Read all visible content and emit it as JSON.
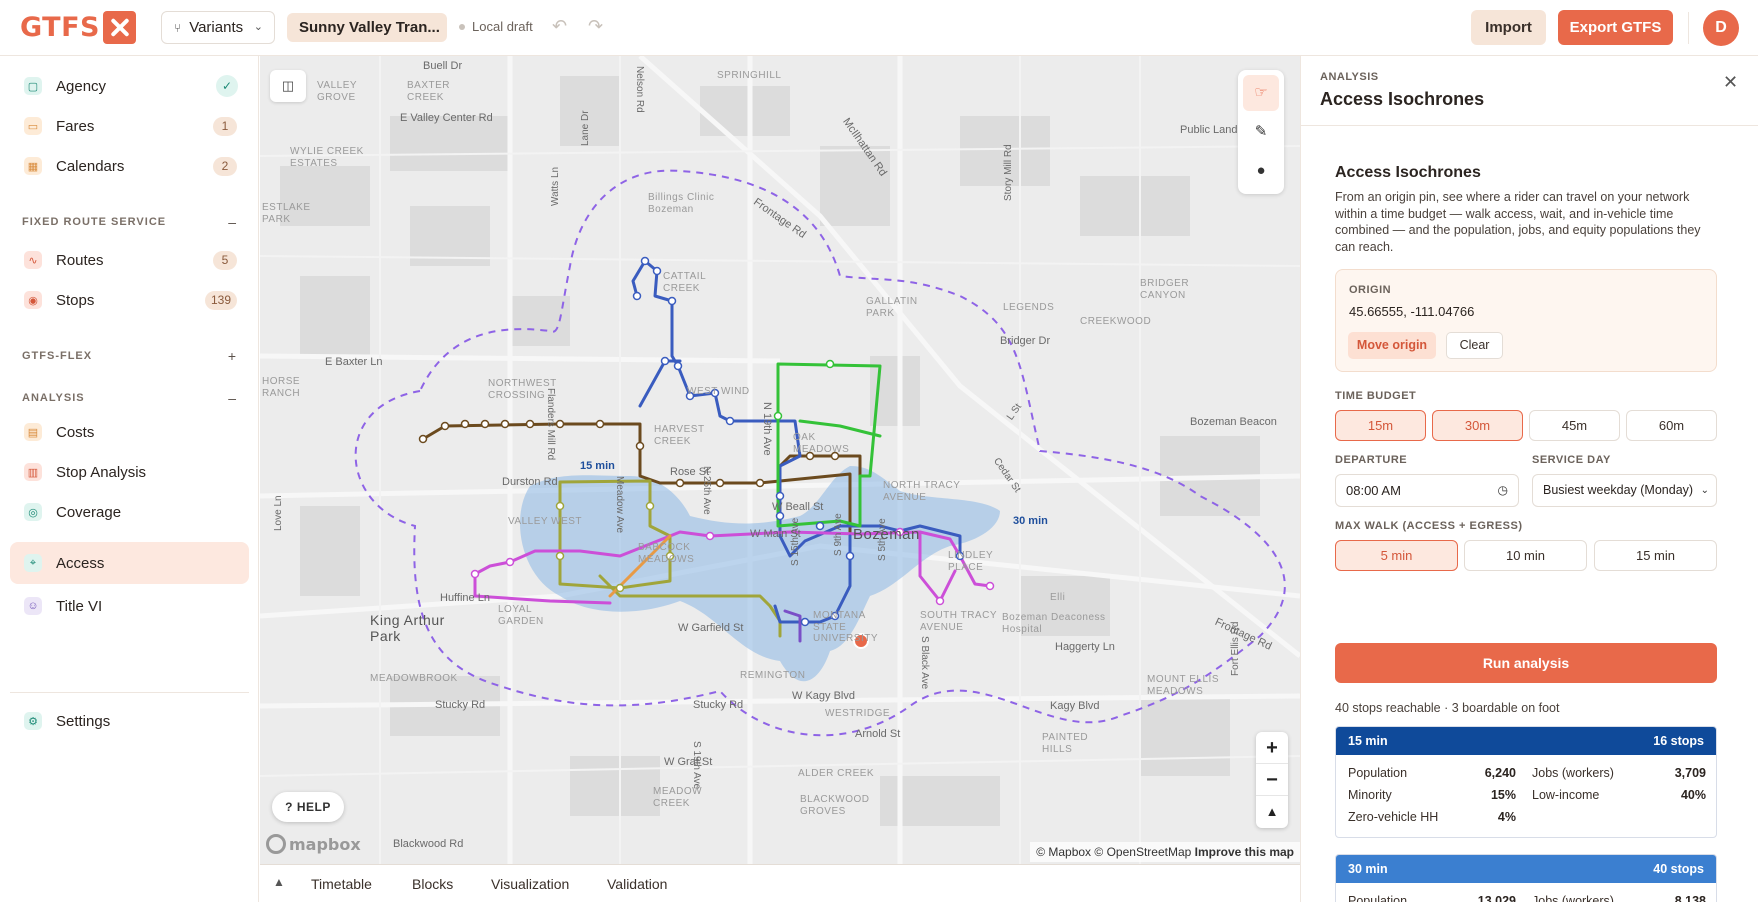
{
  "app": {
    "logo_text": "GTFS",
    "variants_label": "Variants",
    "project_name": "Sunny Valley Tran...",
    "draft_status": "Local draft",
    "import_label": "Import",
    "export_label": "Export GTFS",
    "avatar_initial": "D",
    "accent_color": "#e8694a"
  },
  "sidebar": {
    "top_items": [
      {
        "label": "Agency",
        "status": "check"
      },
      {
        "label": "Fares",
        "badge": "1"
      },
      {
        "label": "Calendars",
        "badge": "2"
      }
    ],
    "sections": {
      "fixed_route": {
        "title": "FIXED ROUTE SERVICE",
        "sign": "–"
      },
      "flex": {
        "title": "GTFS-FLEX",
        "sign": "+"
      },
      "analysis": {
        "title": "ANALYSIS",
        "sign": "–"
      }
    },
    "fixed_items": [
      {
        "label": "Routes",
        "badge": "5"
      },
      {
        "label": "Stops",
        "badge": "139"
      }
    ],
    "analysis_items": [
      {
        "label": "Costs"
      },
      {
        "label": "Stop Analysis"
      },
      {
        "label": "Coverage"
      },
      {
        "label": "Access",
        "active": true
      },
      {
        "label": "Title VI"
      }
    ],
    "settings_label": "Settings"
  },
  "map": {
    "help_label": "HELP",
    "mapbox_label": "mapbox",
    "attribution": {
      "mapbox": "© Mapbox",
      "osm": "© OpenStreetMap",
      "improve": "Improve this map"
    },
    "isochrone_labels": {
      "inner": "15 min",
      "outer": "30 min"
    },
    "place_labels": {
      "valley_grove": "VALLEY\nGROVE",
      "baxter_creek": "BAXTER\nCREEK",
      "e_valley_center": "E Valley Center Rd",
      "springhill": "SPRINGHILL",
      "buell": "Buell Dr",
      "nelson": "Nelson Rd",
      "mcilhattan": "McIlhattan Rd",
      "public_land": "Public Land",
      "wylie": "WYLIE CREEK\nESTATES",
      "westlake": "ESTLAKE\nPARK",
      "billings_clinic": "Billings Clinic\nBozeman",
      "frontage_rd": "Frontage Rd",
      "lane_dr": "Lane Dr",
      "watts_ln": "Watts Ln",
      "story_mill": "Story Mill Rd",
      "bridger_canyon": "BRIDGER\nCANYON",
      "cattail": "CATTAIL\nCREEK",
      "gallatin_park": "GALLATIN\nPARK",
      "legends": "LEGENDS",
      "bridger_dr": "Bridger Dr",
      "creekwood": "CREEKWOOD",
      "e_baxter": "E Baxter Ln",
      "horse_ranch": "HORSE\nRANCH",
      "northwest_crossing": "NORTHWEST\nCROSSING",
      "west_winds": "WEST WIND",
      "flanders": "Flanders Mill Rd",
      "harvest_creek": "HARVEST\nCREEK",
      "n19th": "N 19th Ave",
      "oak_meadows": "OAK\nMEADOWS",
      "l_st": "L St",
      "bozeman_beacon": "Bozeman Beacon",
      "cedar_st": "Cedar St",
      "durston": "Durston Rd",
      "rose_st": "Rose St",
      "meadow_ave": "Meadow Ave",
      "n25th": "N 25th Ave",
      "north_tracy": "NORTH TRACY\nAVENUE",
      "w_beall": "W Beall St",
      "valley_west": "VALLEY WEST",
      "love_ln": "Love Ln",
      "babcock": "BABCOCK\nMEADOWS",
      "bozeman": "Bozeman",
      "lindley": "LINDLEY\nPLACE",
      "s15th": "S 15th Ave",
      "s9th": "S 9th Ave",
      "s5th": "S 5th Ave",
      "huffine": "Huffine Ln",
      "king_arthur": "King Arthur\nPark",
      "loyal_garden": "LOYAL\nGARDEN",
      "w_garfield": "W Garfield St",
      "montana_state": "MONTANA\nSTATE\nUNIVERSITY",
      "south_tracy": "SOUTH TRACY\nAVENUE",
      "s_black": "S Black Ave",
      "deaconess": "Bozeman Deaconess\nHospital",
      "ellis": "Elli",
      "haggerty": "Haggerty Ln",
      "frontage_rd2": "Frontage Rd",
      "meadowbrook": "MEADOWBROOK",
      "remington": "REMINGTON",
      "w_kagy": "W Kagy Blvd",
      "kagy_blvd": "Kagy Blvd",
      "mount_ellis": "MOUNT ELLIS\nMEADOWS",
      "fort_ellis": "Fort Ellis Rd",
      "stucky": "Stucky Rd",
      "stucky2": "Stucky Rd",
      "westridge": "WESTRIDGE",
      "arnold": "Arnold St",
      "s19th": "S 19th Ave",
      "w_graf": "W Graf St",
      "alder_creek": "ALDER CREEK",
      "painted_hills": "PAINTED\nHILLS",
      "meadow_creek": "MEADOW\nCREEK",
      "blackwood_groves": "BLACKWOOD\nGROVES",
      "blackwood_rd": "Blackwood Rd",
      "w_main": "W Main St"
    }
  },
  "bottom_tabs": [
    "Timetable",
    "Blocks",
    "Visualization",
    "Validation"
  ],
  "panel": {
    "eyebrow": "ANALYSIS",
    "title": "Access Isochrones",
    "heading": "Access Isochrones",
    "description": "From an origin pin, see where a rider can travel on your network within a time budget — walk access, wait, and in-vehicle time combined — and the population, jobs, and equity populations they can reach.",
    "origin": {
      "label": "ORIGIN",
      "coords": "45.66555, -111.04766",
      "move_label": "Move origin",
      "clear_label": "Clear"
    },
    "time_budget": {
      "label": "TIME BUDGET",
      "options": [
        "15m",
        "30m",
        "45m",
        "60m"
      ],
      "selected": [
        "15m",
        "30m"
      ]
    },
    "departure": {
      "label": "DEPARTURE",
      "value": "08:00  AM"
    },
    "service_day": {
      "label": "SERVICE DAY",
      "value": "Busiest weekday (Monday)"
    },
    "max_walk": {
      "label": "MAX WALK (ACCESS + EGRESS)",
      "options": [
        "5 min",
        "10 min",
        "15 min"
      ],
      "selected": "5 min"
    },
    "run_label": "Run analysis",
    "summary": "40 stops reachable · 3 boardable on foot",
    "results": [
      {
        "title": "15 min",
        "stops": "16 stops",
        "color": "#0f4a9a",
        "population_label": "Population",
        "population": "6,240",
        "jobs_label": "Jobs (workers)",
        "jobs": "3,709",
        "minority_label": "Minority",
        "minority": "15%",
        "lowincome_label": "Low-income",
        "lowincome": "40%",
        "zerovehicle_label": "Zero-vehicle HH",
        "zerovehicle": "4%"
      },
      {
        "title": "30 min",
        "stops": "40 stops",
        "color": "#3b7fd0",
        "population_label": "Population",
        "population": "13,029",
        "jobs_label": "Jobs (workers)",
        "jobs": "8,138"
      }
    ]
  }
}
